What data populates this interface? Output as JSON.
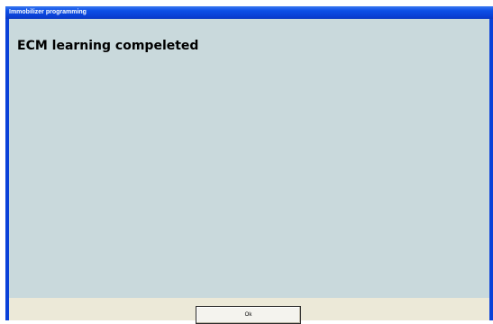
{
  "window": {
    "title": "Immobilizer programming"
  },
  "main": {
    "heading": "ECM learning compeleted"
  },
  "footer": {
    "ok_label": "Ok"
  },
  "colors": {
    "titlebar": "#0a41d8",
    "client_background": "#c9d9dc",
    "footer_background": "#ece9d8"
  }
}
